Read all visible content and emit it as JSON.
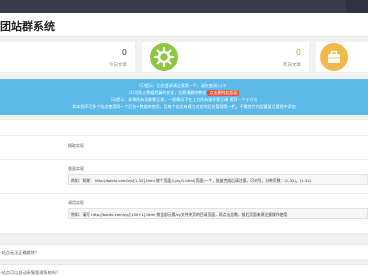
{
  "header": {
    "title": "团站群系统"
  },
  "stats": [
    {
      "value": "0",
      "label": "今日文章"
    },
    {
      "value": "0",
      "label": "昨日文章"
    }
  ],
  "icons": {
    "card2": "gear-icon",
    "card3": "briefcase-icon"
  },
  "colors": {
    "topbar": "#393d49",
    "notice": "#5bb9e8",
    "green": "#8dc63f",
    "orange": "#f0b94a"
  },
  "notice": {
    "line1": "(1)提示：后台登录请注意第一个，请先查阅入口！",
    "line2_pre": "(2)为防止数据泄漏的安全，后期请删除教程 ",
    "line2_badge": "点击删除此版面",
    "line3": "(3)提示：如果所有功能都正常，一般情况下在上方所有操作都正确 推荐一个小方法",
    "line4": "如本程序可多个站点使用同一个后台+数据库使用，且每个站点有建立对应的后台管理等一栏，不需其它内容重复且管理中添加"
  },
  "content": {
    "seg1_label": "摘取实现",
    "seg2_label": "版面实现",
    "seg2_code": "例如：如果： http://baidu.com/zy/[1-32].html 按个页面入/zy/1.html(页面)一个，批量完成后请注意，可对号，分种页数：(1-32)，(1-32)",
    "seg3_label": "调用实现",
    "seg3_code": "例如：请写 http://baidu.com/zy/[100+1].html 按全部元素/zy文件夹页的目录页面，再点击总数，前后页面来源注意操作使用"
  },
  "faq": [
    "-站点无法正确跳转？",
    "-站点可以自动采集管理系统吗？"
  ]
}
